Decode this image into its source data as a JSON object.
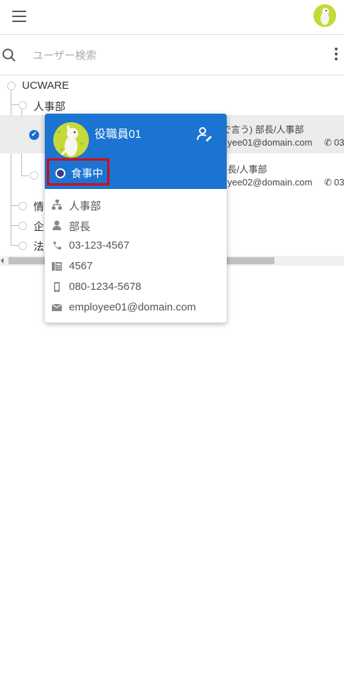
{
  "header": {
    "menu_icon": "hamburger-icon",
    "avatar_icon": "user-avatar-icon"
  },
  "search": {
    "placeholder": "ユーザー検索",
    "value": ""
  },
  "tree": {
    "root": "UCWARE",
    "dept1": "人事部",
    "row1": {
      "name_tail": "で言う) 部長/人事部",
      "email_tail": "yee01@domain.com",
      "phone_tail": "03"
    },
    "row2": {
      "name_tail": "長/人事部",
      "email_tail": "yee02@domain.com",
      "phone_tail": "03"
    },
    "dept2_partial": "情",
    "dept3_partial": "企",
    "dept4_partial": "法"
  },
  "popup": {
    "name": "役職員01",
    "status": "食事中",
    "status_color": "#3a3a8a",
    "header_color": "#1b74d1",
    "highlight_color": "#e00000",
    "department": "人事部",
    "position": "部長",
    "phone": "03-123-4567",
    "extension": "4567",
    "mobile": "080-1234-5678",
    "email": "employee01@domain.com"
  }
}
